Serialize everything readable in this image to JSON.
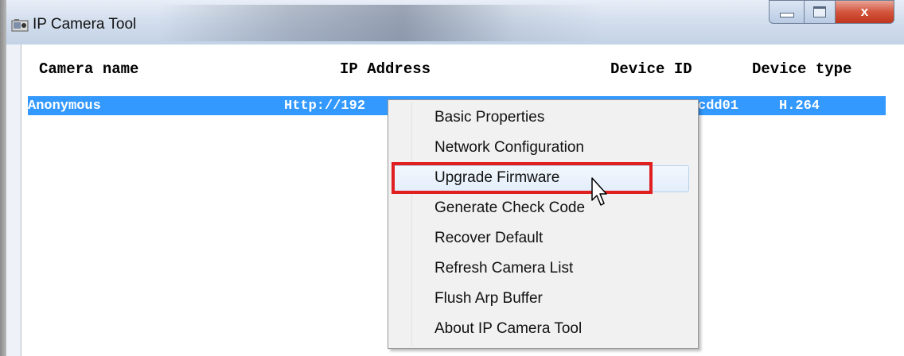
{
  "window": {
    "title": "IP Camera Tool",
    "close_glyph": "x"
  },
  "table": {
    "columns": [
      "Camera name",
      "IP Address",
      "Device ID",
      "Device type"
    ],
    "rows": [
      {
        "camera_name": "Anonymous",
        "ip_address": "Http://192",
        "device_id": "cdd01",
        "device_type": "H.264",
        "selected": true
      }
    ]
  },
  "context_menu": {
    "items": [
      "Basic Properties",
      "Network Configuration",
      "Upgrade Firmware",
      "Generate Check Code",
      "Recover Default",
      "Refresh Camera List",
      "Flush Arp Buffer",
      "About IP Camera Tool"
    ],
    "hovered_item": "Upgrade Firmware"
  },
  "colors": {
    "selection": "#3399ff",
    "highlight_box": "#e02020",
    "close_button": "#c0361d"
  },
  "icons": [
    "camera-app-icon",
    "minimize-icon",
    "maximize-icon",
    "close-icon",
    "mouse-cursor-icon"
  ]
}
